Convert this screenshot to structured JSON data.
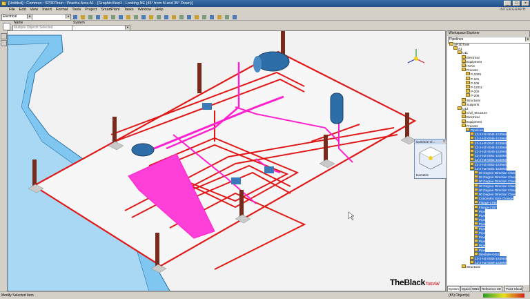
{
  "window": {
    "title": "[Untitled] : Common : SP3DTrain : Piranha Area A1 - [GraphicView1 - Looking NE (45° from N and 35° Down)]",
    "min": "_",
    "max": "□",
    "close": "×"
  },
  "brand_top": "INTERGRAPH",
  "menu": [
    "File",
    "Edit",
    "View",
    "Insert",
    "Format",
    "Tools",
    "Project",
    "SmartPlant",
    "Tasks",
    "Window",
    "Help"
  ],
  "toolbar": {
    "task_combo": "Electrical",
    "filter_combo": ""
  },
  "properties": {
    "name_label": "Name",
    "name_value": "Multiple Objects Selected",
    "system_label": "System",
    "system_value": ""
  },
  "common_views": {
    "title": "Common Vi...",
    "label": "Isometric"
  },
  "workspace_explorer": {
    "title": "Workspace Explorer",
    "combo": "Pipelines",
    "tree": [
      {
        "label": "SP3DTrain",
        "indent": 0,
        "sel": false
      },
      {
        "label": "A1",
        "indent": 1,
        "sel": false
      },
      {
        "label": "U11",
        "indent": 2,
        "sel": false
      },
      {
        "label": "Electrical",
        "indent": 3,
        "sel": false
      },
      {
        "label": "Equipment",
        "indent": 3,
        "sel": false
      },
      {
        "label": "HVAC",
        "indent": 3,
        "sel": false
      },
      {
        "label": "Process",
        "indent": 3,
        "sel": false
      },
      {
        "label": "P-100S",
        "indent": 4,
        "sel": false
      },
      {
        "label": "P-101",
        "indent": 4,
        "sel": false
      },
      {
        "label": "P-106",
        "indent": 4,
        "sel": false
      },
      {
        "label": "P-12011",
        "indent": 4,
        "sel": false
      },
      {
        "label": "P-200",
        "indent": 4,
        "sel": false
      },
      {
        "label": "P-208",
        "indent": 4,
        "sel": false
      },
      {
        "label": "Structural",
        "indent": 3,
        "sel": false
      },
      {
        "label": "Supports",
        "indent": 3,
        "sel": false
      },
      {
        "label": "U12",
        "indent": 2,
        "sel": false
      },
      {
        "label": "Civil_Structure",
        "indent": 3,
        "sel": false
      },
      {
        "label": "Electrical",
        "indent": 3,
        "sel": false
      },
      {
        "label": "Equipment",
        "indent": 3,
        "sel": false
      },
      {
        "label": "Process",
        "indent": 3,
        "sel": false
      },
      {
        "label": "Pipelines",
        "indent": 4,
        "sel": true
      },
      {
        "label": "12-2-HZ-0045-1S3964",
        "indent": 5,
        "sel": true
      },
      {
        "label": "12-2-HZ-0046-1S3964",
        "indent": 5,
        "sel": true
      },
      {
        "label": "12-2-HZ-0047-1S3964",
        "indent": 5,
        "sel": true
      },
      {
        "label": "12-2-HZ-0048-1S3964",
        "indent": 5,
        "sel": true
      },
      {
        "label": "12-2-HZ-0049-1S3964",
        "indent": 5,
        "sel": true
      },
      {
        "label": "12-2-HZ-0051-1S3964",
        "indent": 5,
        "sel": true
      },
      {
        "label": "12-2-HZ-0052-1S3964",
        "indent": 5,
        "sel": true
      },
      {
        "label": "12-2-HZ-0053-1S3964",
        "indent": 5,
        "sel": true
      },
      {
        "label": "12-2-HZ-0054-1S3964",
        "indent": 5,
        "sel": true
      },
      {
        "label": "90 Degree Direction Chan",
        "indent": 6,
        "sel": true
      },
      {
        "label": "90 Degree Direction Chan",
        "indent": 6,
        "sel": true
      },
      {
        "label": "90 Degree Direction Chan",
        "indent": 6,
        "sel": true
      },
      {
        "label": "90 Degree Direction Chan",
        "indent": 6,
        "sel": true
      },
      {
        "label": "90 Degree Direction Chan",
        "indent": 6,
        "sel": true
      },
      {
        "label": "90 Degree Direction Chan",
        "indent": 6,
        "sel": true
      },
      {
        "label": "Concentric Size Change",
        "indent": 6,
        "sel": true
      },
      {
        "label": "Flange-1706",
        "indent": 6,
        "sel": true
      },
      {
        "label": "Flange-1707",
        "indent": 6,
        "sel": true
      },
      {
        "label": "Pipe",
        "indent": 6,
        "sel": true
      },
      {
        "label": "Pipe",
        "indent": 6,
        "sel": true
      },
      {
        "label": "Pipe",
        "indent": 6,
        "sel": true
      },
      {
        "label": "Pipe",
        "indent": 6,
        "sel": true
      },
      {
        "label": "Pipe",
        "indent": 6,
        "sel": true
      },
      {
        "label": "Pipe",
        "indent": 6,
        "sel": true
      },
      {
        "label": "Pipe",
        "indent": 6,
        "sel": true
      },
      {
        "label": "Pipe",
        "indent": 6,
        "sel": true
      },
      {
        "label": "Pipe",
        "indent": 6,
        "sel": true
      },
      {
        "label": "Pipe",
        "indent": 6,
        "sel": true
      },
      {
        "label": "Weldolet-0451",
        "indent": 6,
        "sel": true
      },
      {
        "label": "12-2-HZ-0055-1S3964",
        "indent": 5,
        "sel": true
      },
      {
        "label": "12-2-HZ-0056-1S3964",
        "indent": 5,
        "sel": true
      },
      {
        "label": "Structural",
        "indent": 3,
        "sel": false
      }
    ],
    "tabs": [
      "System",
      "Space",
      "WBS",
      "Reference 3D",
      "Point Cloud"
    ]
  },
  "statusbar": {
    "text": "Modify Selected Item",
    "count": "(85) Object(s)"
  },
  "watermark": {
    "main": "TheBlack",
    "sub": "Tutorial"
  }
}
